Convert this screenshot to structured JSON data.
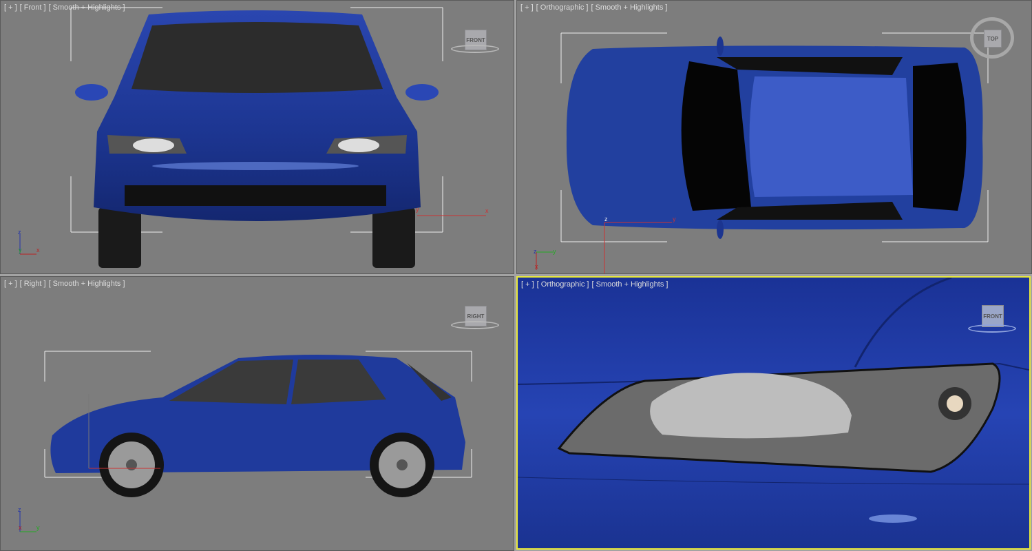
{
  "viewports": [
    {
      "id": "front",
      "labels": [
        "[ + ]",
        "[ Front ]",
        "[ Smooth + Highlights ]"
      ],
      "viewcube": "FRONT",
      "axes": {
        "up": "z",
        "left": "y",
        "right": "x"
      }
    },
    {
      "id": "top",
      "labels": [
        "[ + ]",
        "[ Orthographic ]",
        "[ Smooth + Highlights ]"
      ],
      "viewcube": "TOP",
      "axes": {
        "up": "y",
        "left": "z",
        "right": "x"
      }
    },
    {
      "id": "right",
      "labels": [
        "[ + ]",
        "[ Right ]",
        "[ Smooth + Highlights ]"
      ],
      "viewcube": "RIGHT",
      "axes": {
        "up": "z",
        "left": "x",
        "right": "y"
      }
    },
    {
      "id": "persp",
      "labels": [
        "[ + ]",
        "[ Orthographic ]",
        "[ Smooth + Highlights ]"
      ],
      "viewcube": "FRONT",
      "active": true
    }
  ],
  "gizmo": {
    "x": "x",
    "y": "y",
    "z": "z"
  },
  "colors": {
    "viewport_bg": "#7d7d7d",
    "car_blue": "#1f3a9c",
    "active_border": "#e8e83a"
  }
}
